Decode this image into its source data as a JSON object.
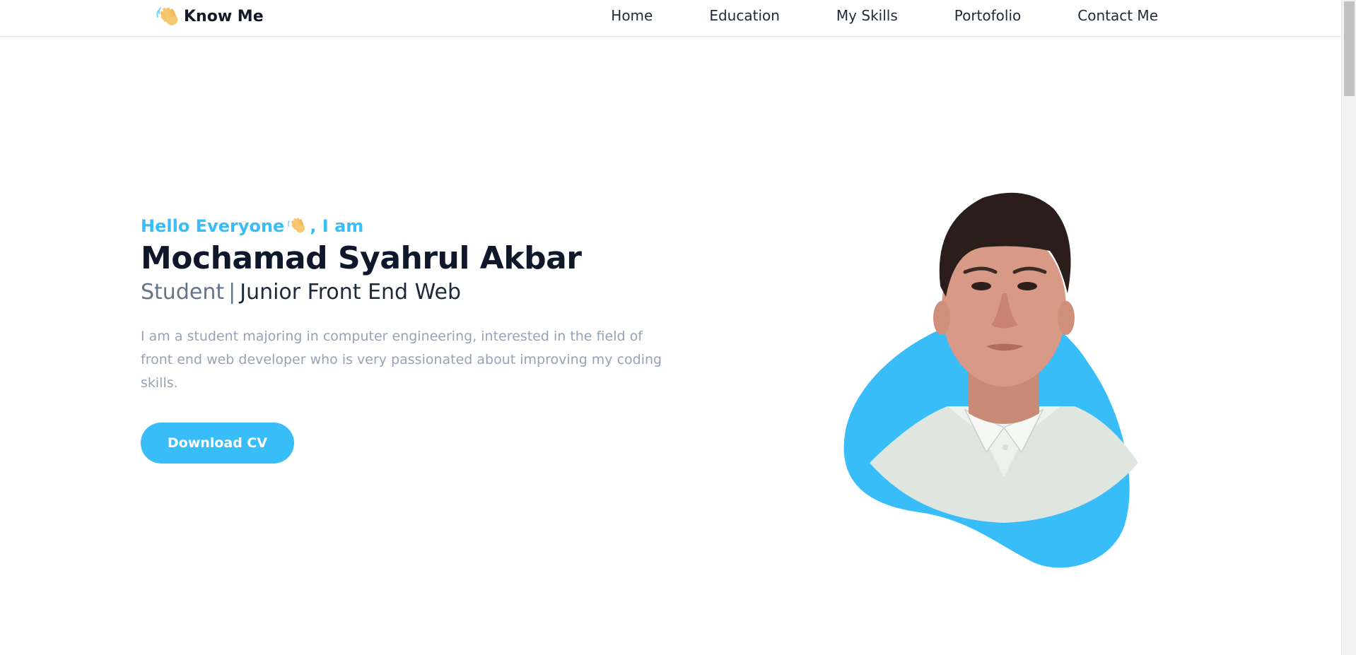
{
  "brand": {
    "name": "Know Me",
    "icon": "waving-hand-icon"
  },
  "nav": {
    "items": [
      {
        "label": "Home"
      },
      {
        "label": "Education"
      },
      {
        "label": "My Skills"
      },
      {
        "label": "Portofolio"
      },
      {
        "label": "Contact Me"
      }
    ]
  },
  "hero": {
    "greeting_before": "Hello Everyone",
    "greeting_icon": "waving-hand-icon",
    "greeting_after": ", I am",
    "name": "Mochamad Syahrul Akbar",
    "role_primary": "Student",
    "role_separator": "|",
    "role_secondary": "Junior Front End Web",
    "description": "I am a student majoring in computer engineering, interested in the field of front end web developer who is very passionated about improving my coding skills.",
    "cta_label": "Download CV"
  },
  "portrait": {
    "icon": "profile-photo"
  },
  "colors": {
    "accent": "#38bdf8",
    "heading": "#0f172a",
    "muted": "#94a3b8",
    "nav_text": "#1f2937"
  }
}
